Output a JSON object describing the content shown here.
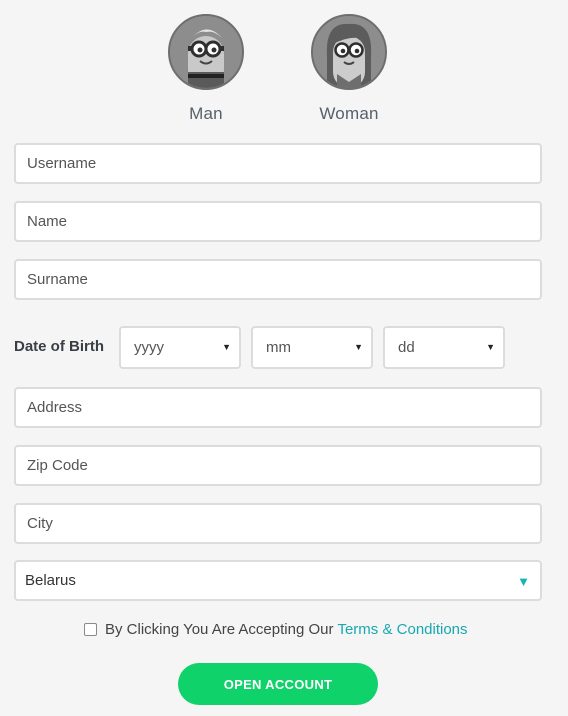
{
  "gender": {
    "man_label": "Man",
    "woman_label": "Woman"
  },
  "form": {
    "username_placeholder": "Username",
    "name_placeholder": "Name",
    "surname_placeholder": "Surname",
    "dob_label": "Date of Birth",
    "dob_year": "yyyy",
    "dob_month": "mm",
    "dob_day": "dd",
    "address_placeholder": "Address",
    "zip_placeholder": "Zip Code",
    "city_placeholder": "City",
    "country_value": "Belarus"
  },
  "terms": {
    "text": "By Clicking You Are Accepting Our",
    "link": "Terms & Conditions"
  },
  "submit": {
    "label": "OPEN ACCOUNT"
  },
  "colors": {
    "accent_green": "#0fd26a",
    "link_teal": "#17a8b0",
    "arrow_teal": "#14b3b8"
  }
}
